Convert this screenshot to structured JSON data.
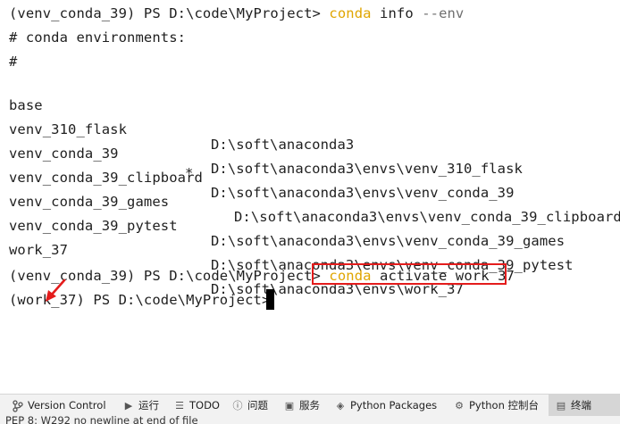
{
  "terminal": {
    "cmd1": {
      "prompt": "(venv_conda_39) PS D:\\code\\MyProject> ",
      "keyword": "conda",
      "command": "info",
      "flag": "--env"
    },
    "header1": "# conda environments:",
    "header2": "#",
    "environments": [
      {
        "name": "base",
        "active": "",
        "path": "D:\\soft\\anaconda3"
      },
      {
        "name": "venv_310_flask",
        "active": "",
        "path": "D:\\soft\\anaconda3\\envs\\venv_310_flask"
      },
      {
        "name": "venv_conda_39",
        "active": "*",
        "path": "D:\\soft\\anaconda3\\envs\\venv_conda_39"
      },
      {
        "name": "venv_conda_39_clipboard",
        "active": "",
        "path": "D:\\soft\\anaconda3\\envs\\venv_conda_39_clipboard"
      },
      {
        "name": "venv_conda_39_games",
        "active": "",
        "path": "D:\\soft\\anaconda3\\envs\\venv_conda_39_games"
      },
      {
        "name": "venv_conda_39_pytest",
        "active": "",
        "path": "D:\\soft\\anaconda3\\envs\\venv_conda_39_pytest"
      },
      {
        "name": "work_37",
        "active": "",
        "path": "D:\\soft\\anaconda3\\envs\\work_37"
      }
    ],
    "cmd2": {
      "prompt": "(venv_conda_39) PS D:\\code\\MyProject> ",
      "keyword": "conda",
      "command": "activate work_37"
    },
    "prompt3": "(work_37) PS D:\\code\\MyProject> ",
    "highlight_color": "#e41c1c",
    "keyword_color": "#e0a500"
  },
  "toolbar": {
    "items": [
      {
        "label": "Version Control",
        "icon": "branch-icon"
      },
      {
        "label": "运行",
        "icon": "run-icon"
      },
      {
        "label": "TODO",
        "icon": "list-icon"
      },
      {
        "label": "问题",
        "icon": "problems-icon"
      },
      {
        "label": "服务",
        "icon": "services-icon"
      },
      {
        "label": "Python Packages",
        "icon": "packages-icon"
      },
      {
        "label": "Python 控制台",
        "icon": "python-console-icon"
      },
      {
        "label": "终端",
        "icon": "terminal-icon"
      }
    ]
  },
  "status": {
    "message": "PEP 8: W292 no newline at end of file"
  }
}
